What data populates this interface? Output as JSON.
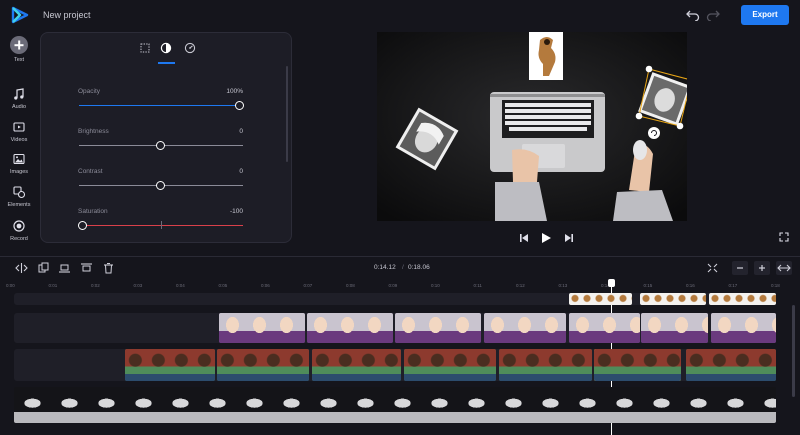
{
  "app": {
    "project_title": "New project",
    "export_label": "Export",
    "accent_color": "#1e78f0"
  },
  "rail": {
    "items": [
      {
        "label": "Text",
        "icon": "plus-icon"
      },
      {
        "label": "Audio",
        "icon": "music-note-icon"
      },
      {
        "label": "Videos",
        "icon": "video-icon"
      },
      {
        "label": "Images",
        "icon": "image-icon"
      },
      {
        "label": "Elements",
        "icon": "shapes-icon"
      },
      {
        "label": "Record",
        "icon": "record-icon"
      }
    ]
  },
  "panel": {
    "tabs": [
      {
        "icon": "crop-icon",
        "active": false
      },
      {
        "icon": "contrast-icon",
        "active": true
      },
      {
        "icon": "speed-icon",
        "active": false
      }
    ],
    "params": [
      {
        "label": "Opacity",
        "value": "100%",
        "level": 1.0
      },
      {
        "label": "Brightness",
        "value": "0",
        "level": 0.5
      },
      {
        "label": "Contrast",
        "value": "0",
        "level": 0.5
      },
      {
        "label": "Saturation",
        "value": "-100",
        "level": 0.0
      }
    ]
  },
  "timeline": {
    "current_time": "0:14.12",
    "separator": "/",
    "total_time": "0:18.06",
    "ticks": [
      "0:00",
      "0:01",
      "0:02",
      "0:03",
      "0:04",
      "0:05",
      "0:06",
      "0:07",
      "0:08",
      "0:09",
      "0:10",
      "0:11",
      "0:12",
      "0:13",
      "0:14",
      "0:15",
      "0:16",
      "0:17",
      "0:18"
    ],
    "toolbar_icons": [
      "split-icon",
      "duplicate-icon",
      "align-bottom-icon",
      "align-top-icon",
      "trash-icon"
    ],
    "zoom_icons": [
      "fit-icon",
      "zoom-out-icon",
      "zoom-in-icon",
      "expand-icon"
    ]
  }
}
